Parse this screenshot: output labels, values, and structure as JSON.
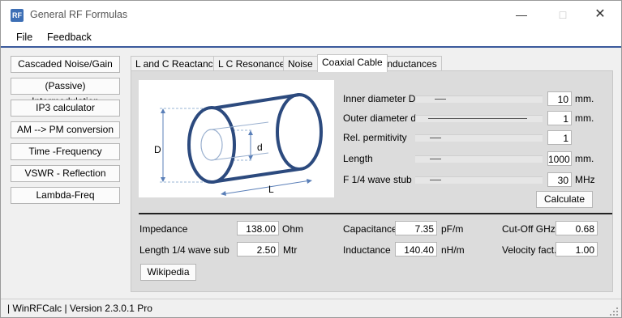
{
  "window": {
    "title": "General RF Formulas",
    "icon_text": "RF"
  },
  "menu": [
    "File",
    "Feedback"
  ],
  "sidebar": [
    "Cascaded Noise/Gain",
    "(Passive) Intermodulation",
    "IP3 calculator",
    "AM --> PM conversion",
    "Time -Frequency",
    "VSWR - Reflection",
    "Lambda-Freq"
  ],
  "tabs": [
    "L and C Reactance",
    "L C Resonance",
    "Noise",
    "Coaxial Cable",
    "Inductances"
  ],
  "active_tab": 3,
  "diagram": {
    "label_D": "D",
    "label_d": "d",
    "label_L": "L"
  },
  "inputs": {
    "inner_diameter": {
      "label": "Inner diameter D",
      "value": "10",
      "unit": "mm.",
      "slider_level": 0.12
    },
    "outer_diameter": {
      "label": "Outer diameter d",
      "value": "1",
      "unit": "mm.",
      "slider_level": 0.9
    },
    "permittivity": {
      "label": "Rel. permitivity",
      "value": "1",
      "slider_level": 0.12
    },
    "length": {
      "label": "Length",
      "value": "1000",
      "unit": "mm.",
      "slider_level": 0.12
    },
    "stub_freq": {
      "label": "F 1/4 wave stub",
      "value": "30",
      "unit": "MHz",
      "slider_level": 0.12
    }
  },
  "calculate_label": "Calculate",
  "results": {
    "impedance": {
      "label": "Impedance",
      "value": "138.00",
      "unit": "Ohm"
    },
    "length_quarter": {
      "label": "Length 1/4 wave sub",
      "value": "2.50",
      "unit": "Mtr"
    },
    "capacitance": {
      "label": "Capacitance",
      "value": "7.35",
      "unit": "pF/m"
    },
    "inductance": {
      "label": "Inductance",
      "value": "140.40",
      "unit": "nH/m"
    },
    "cutoff": {
      "label": "Cut-Off GHz",
      "value": "0.68"
    },
    "velocity": {
      "label": "Velocity fact.",
      "value": "1.00"
    }
  },
  "wikipedia_label": "Wikipedia",
  "status": "| WinRFCalc | Version 2.3.0.1 Pro",
  "colors": {
    "accent": "#3a5a9c",
    "cable": "#2c4a7e"
  }
}
